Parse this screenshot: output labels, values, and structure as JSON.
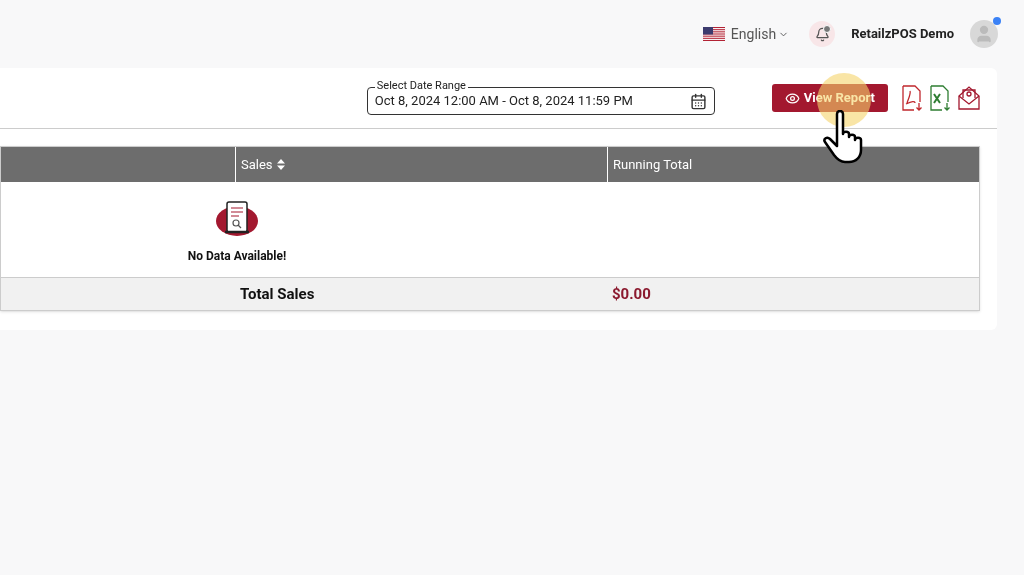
{
  "header": {
    "language": "English",
    "user_name": "RetailzPOS Demo",
    "notification_dot": true
  },
  "filters": {
    "date_range": {
      "label": "Select Date Range",
      "value": "Oct 8, 2024 12:00 AM - Oct 8, 2024 11:59 PM"
    },
    "view_button": "View Report"
  },
  "table": {
    "columns": [
      {
        "label": "Sales",
        "sortable": true
      },
      {
        "label": "Running Total",
        "sortable": false
      }
    ],
    "empty_message": "No Data Available!",
    "footer": {
      "label": "Total Sales",
      "value": "$0.00"
    }
  }
}
